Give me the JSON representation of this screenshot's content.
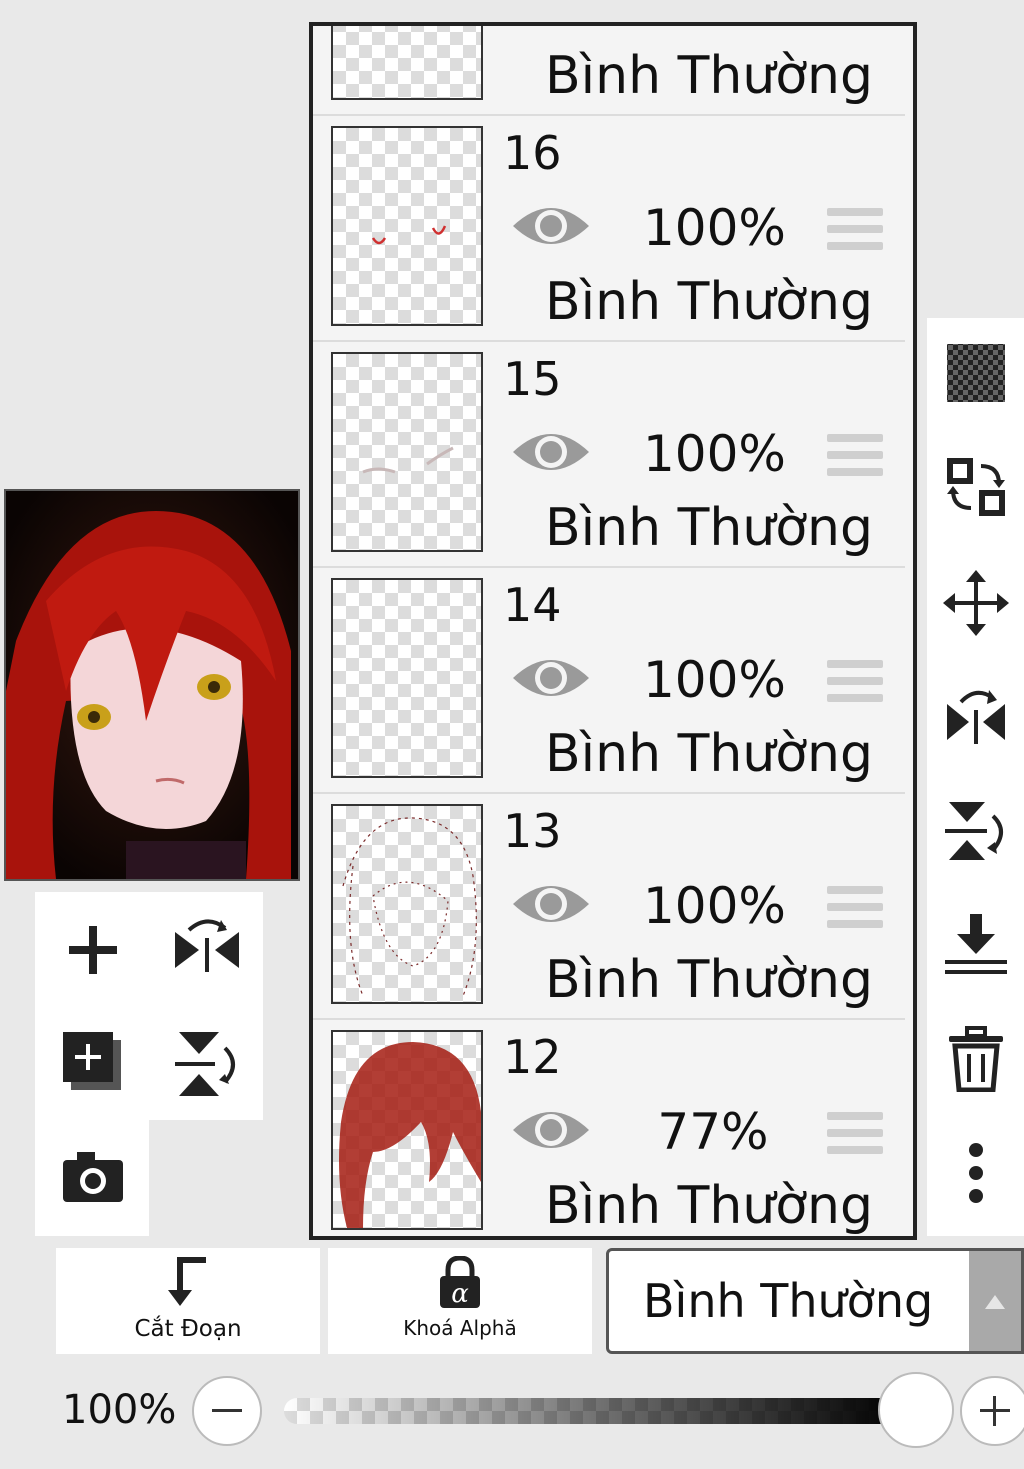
{
  "layers": [
    {
      "number": "",
      "opacity": "",
      "blend": "Bình Thường",
      "thumb": "blank"
    },
    {
      "number": "16",
      "opacity": "100%",
      "blend": "Bình Thường",
      "thumb": "mouth-marks"
    },
    {
      "number": "15",
      "opacity": "100%",
      "blend": "Bình Thường",
      "thumb": "brow-marks"
    },
    {
      "number": "14",
      "opacity": "100%",
      "blend": "Bình Thường",
      "thumb": "blank"
    },
    {
      "number": "13",
      "opacity": "100%",
      "blend": "Bình Thường",
      "thumb": "lineart"
    },
    {
      "number": "12",
      "opacity": "77%",
      "blend": "Bình Thường",
      "thumb": "hair"
    }
  ],
  "right_toolbar": [
    "transparency-icon",
    "swap-layers-icon",
    "move-icon",
    "flip-horizontal-icon",
    "flip-vertical-icon",
    "merge-down-icon",
    "trash-icon",
    "more-vert-icon"
  ],
  "left_tools": [
    "add-layer-icon",
    "flip-horizontal-icon",
    "add-layer-copy-icon",
    "flip-vertical-icon",
    "camera-icon"
  ],
  "bottom": {
    "clip_label": "Cắt Đoạn",
    "alpha_lock_label": "Khoá Alphă",
    "blend_mode_value": "Bình Thường",
    "opacity_value": "100%"
  },
  "opacity_slider": {
    "value": 1.0
  },
  "colors": {
    "panel_border": "#222222",
    "eye": "#9a9a9a",
    "hair": "#b01a10"
  }
}
